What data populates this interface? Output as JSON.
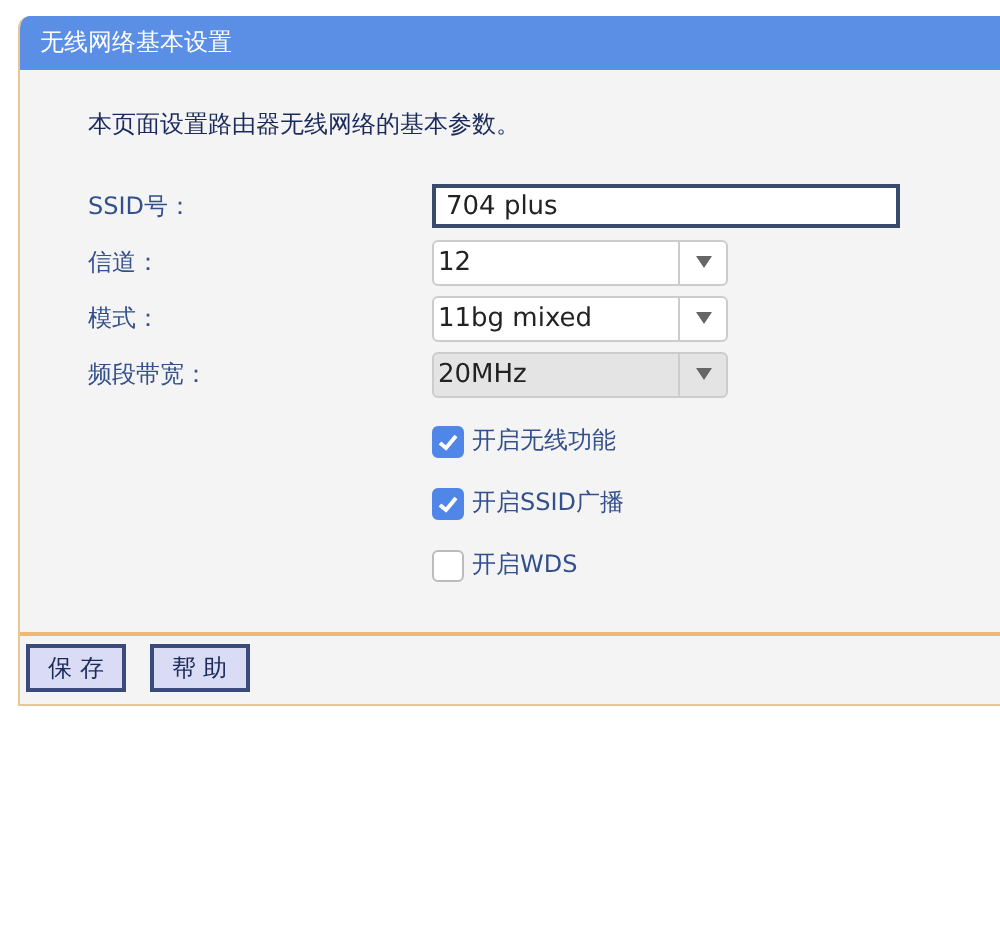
{
  "title": "无线网络基本设置",
  "description": "本页面设置路由器无线网络的基本参数。",
  "fields": [
    {
      "kind": "text",
      "label": "SSID号：",
      "value": "704 plus"
    },
    {
      "kind": "select",
      "label": "信道：",
      "value": "12",
      "disabled": false
    },
    {
      "kind": "select",
      "label": "模式：",
      "value": "11bg mixed",
      "disabled": false
    },
    {
      "kind": "select",
      "label": "频段带宽：",
      "value": "20MHz",
      "disabled": true
    }
  ],
  "options": [
    {
      "label": "开启无线功能",
      "checked": true
    },
    {
      "label": "开启SSID广播",
      "checked": true
    },
    {
      "label": "开启WDS",
      "checked": false
    }
  ],
  "buttons": [
    "保 存",
    "帮 助"
  ]
}
